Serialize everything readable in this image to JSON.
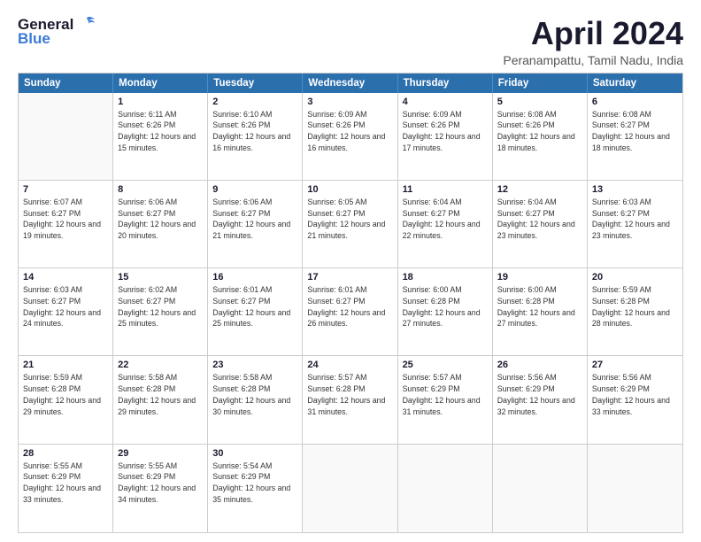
{
  "header": {
    "logo_general": "General",
    "logo_blue": "Blue",
    "title": "April 2024",
    "location": "Peranampattu, Tamil Nadu, India"
  },
  "calendar": {
    "days_of_week": [
      "Sunday",
      "Monday",
      "Tuesday",
      "Wednesday",
      "Thursday",
      "Friday",
      "Saturday"
    ],
    "weeks": [
      [
        {
          "day": "",
          "empty": true
        },
        {
          "day": "1",
          "sunrise": "6:11 AM",
          "sunset": "6:26 PM",
          "daylight": "12 hours and 15 minutes."
        },
        {
          "day": "2",
          "sunrise": "6:10 AM",
          "sunset": "6:26 PM",
          "daylight": "12 hours and 16 minutes."
        },
        {
          "day": "3",
          "sunrise": "6:09 AM",
          "sunset": "6:26 PM",
          "daylight": "12 hours and 16 minutes."
        },
        {
          "day": "4",
          "sunrise": "6:09 AM",
          "sunset": "6:26 PM",
          "daylight": "12 hours and 17 minutes."
        },
        {
          "day": "5",
          "sunrise": "6:08 AM",
          "sunset": "6:26 PM",
          "daylight": "12 hours and 18 minutes."
        },
        {
          "day": "6",
          "sunrise": "6:08 AM",
          "sunset": "6:27 PM",
          "daylight": "12 hours and 18 minutes."
        }
      ],
      [
        {
          "day": "7",
          "sunrise": "6:07 AM",
          "sunset": "6:27 PM",
          "daylight": "12 hours and 19 minutes."
        },
        {
          "day": "8",
          "sunrise": "6:06 AM",
          "sunset": "6:27 PM",
          "daylight": "12 hours and 20 minutes."
        },
        {
          "day": "9",
          "sunrise": "6:06 AM",
          "sunset": "6:27 PM",
          "daylight": "12 hours and 21 minutes."
        },
        {
          "day": "10",
          "sunrise": "6:05 AM",
          "sunset": "6:27 PM",
          "daylight": "12 hours and 21 minutes."
        },
        {
          "day": "11",
          "sunrise": "6:04 AM",
          "sunset": "6:27 PM",
          "daylight": "12 hours and 22 minutes."
        },
        {
          "day": "12",
          "sunrise": "6:04 AM",
          "sunset": "6:27 PM",
          "daylight": "12 hours and 23 minutes."
        },
        {
          "day": "13",
          "sunrise": "6:03 AM",
          "sunset": "6:27 PM",
          "daylight": "12 hours and 23 minutes."
        }
      ],
      [
        {
          "day": "14",
          "sunrise": "6:03 AM",
          "sunset": "6:27 PM",
          "daylight": "12 hours and 24 minutes."
        },
        {
          "day": "15",
          "sunrise": "6:02 AM",
          "sunset": "6:27 PM",
          "daylight": "12 hours and 25 minutes."
        },
        {
          "day": "16",
          "sunrise": "6:01 AM",
          "sunset": "6:27 PM",
          "daylight": "12 hours and 25 minutes."
        },
        {
          "day": "17",
          "sunrise": "6:01 AM",
          "sunset": "6:27 PM",
          "daylight": "12 hours and 26 minutes."
        },
        {
          "day": "18",
          "sunrise": "6:00 AM",
          "sunset": "6:28 PM",
          "daylight": "12 hours and 27 minutes."
        },
        {
          "day": "19",
          "sunrise": "6:00 AM",
          "sunset": "6:28 PM",
          "daylight": "12 hours and 27 minutes."
        },
        {
          "day": "20",
          "sunrise": "5:59 AM",
          "sunset": "6:28 PM",
          "daylight": "12 hours and 28 minutes."
        }
      ],
      [
        {
          "day": "21",
          "sunrise": "5:59 AM",
          "sunset": "6:28 PM",
          "daylight": "12 hours and 29 minutes."
        },
        {
          "day": "22",
          "sunrise": "5:58 AM",
          "sunset": "6:28 PM",
          "daylight": "12 hours and 29 minutes."
        },
        {
          "day": "23",
          "sunrise": "5:58 AM",
          "sunset": "6:28 PM",
          "daylight": "12 hours and 30 minutes."
        },
        {
          "day": "24",
          "sunrise": "5:57 AM",
          "sunset": "6:28 PM",
          "daylight": "12 hours and 31 minutes."
        },
        {
          "day": "25",
          "sunrise": "5:57 AM",
          "sunset": "6:29 PM",
          "daylight": "12 hours and 31 minutes."
        },
        {
          "day": "26",
          "sunrise": "5:56 AM",
          "sunset": "6:29 PM",
          "daylight": "12 hours and 32 minutes."
        },
        {
          "day": "27",
          "sunrise": "5:56 AM",
          "sunset": "6:29 PM",
          "daylight": "12 hours and 33 minutes."
        }
      ],
      [
        {
          "day": "28",
          "sunrise": "5:55 AM",
          "sunset": "6:29 PM",
          "daylight": "12 hours and 33 minutes."
        },
        {
          "day": "29",
          "sunrise": "5:55 AM",
          "sunset": "6:29 PM",
          "daylight": "12 hours and 34 minutes."
        },
        {
          "day": "30",
          "sunrise": "5:54 AM",
          "sunset": "6:29 PM",
          "daylight": "12 hours and 35 minutes."
        },
        {
          "day": "",
          "empty": true
        },
        {
          "day": "",
          "empty": true
        },
        {
          "day": "",
          "empty": true
        },
        {
          "day": "",
          "empty": true
        }
      ]
    ]
  }
}
